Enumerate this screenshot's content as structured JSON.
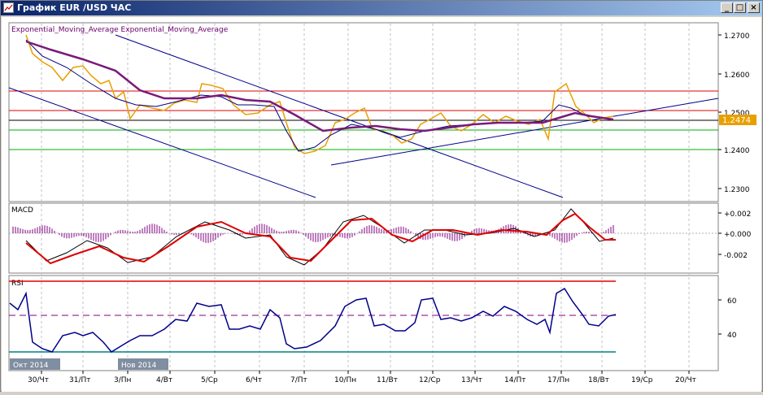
{
  "window": {
    "title": "График EUR /USD ЧАС",
    "minimize_icon": "minimize-icon",
    "maximize_icon": "maximize-icon",
    "close_icon": "close-icon"
  },
  "price_panel": {
    "indicator_label": "Exponential_Moving_Average Exponential_Moving_Average",
    "y_ticks": [
      "1.2700",
      "1.2600",
      "1.2500",
      "1.2400",
      "1.2300"
    ],
    "current_price": "1.2474",
    "horizontal_levels": [
      1.2555,
      1.2505,
      1.2475,
      1.2453,
      1.24
    ],
    "colors": {
      "price": "#e8a000",
      "ema_slow": "#7a1a7a",
      "ema_fast": "#000080",
      "red_level": "#e00000",
      "green_level": "#00b000",
      "black_level": "#000000",
      "trendline": "#00008b"
    }
  },
  "macd_panel": {
    "label": "MACD",
    "y_ticks": [
      "+0.002",
      "+0.000",
      "-0.002"
    ],
    "colors": {
      "signal": "#e00000",
      "macd": "#000000",
      "histogram": "#800080"
    }
  },
  "rsi_panel": {
    "label": "RSI",
    "y_ticks": [
      "60",
      "40"
    ],
    "colors": {
      "rsi": "#00008b",
      "overbought": "#e00000",
      "oversold": "#008080",
      "mid": "#800080"
    }
  },
  "x_axis": {
    "labels": [
      "30/Чт",
      "31/Пт",
      "3/Пн",
      "4/Вт",
      "5/Ср",
      "6/Чт",
      "7/Пт",
      "10/Пн",
      "11/Вт",
      "12/Ср",
      "13/Чт",
      "14/Пт",
      "17/Пн",
      "18/Вт",
      "19/Ср",
      "20/Чт"
    ],
    "month_markers": [
      "Окт 2014",
      "Нов 2014"
    ]
  }
}
